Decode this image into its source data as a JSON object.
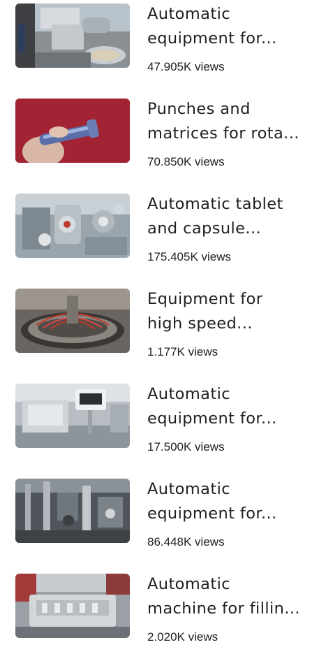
{
  "videos": [
    {
      "title_lines": [
        "Automatic",
        "equipment for..."
      ],
      "views": "47.905K views",
      "thumb_icon": "meat-grinder-machine-image"
    },
    {
      "title_lines": [
        "Punches and",
        "matrices for rota..."
      ],
      "views": "70.850K views",
      "thumb_icon": "punch-tool-in-hand-image"
    },
    {
      "title_lines": [
        "Automatic tablet",
        "and capsule..."
      ],
      "views": "175.405K views",
      "thumb_icon": "tablet-capsule-machine-image"
    },
    {
      "title_lines": [
        "Equipment for",
        "high speed..."
      ],
      "views": "1.177K views",
      "thumb_icon": "rotary-press-machine-image"
    },
    {
      "title_lines": [
        "Automatic",
        "equipment for..."
      ],
      "views": "17.500K views",
      "thumb_icon": "control-panel-machine-image"
    },
    {
      "title_lines": [
        "Automatic",
        "equipment for..."
      ],
      "views": "86.448K views",
      "thumb_icon": "filling-line-machine-image"
    },
    {
      "title_lines": [
        "Automatic",
        "machine for fillin..."
      ],
      "views": "2.020K views",
      "thumb_icon": "filling-machine-trade-show-image"
    }
  ]
}
